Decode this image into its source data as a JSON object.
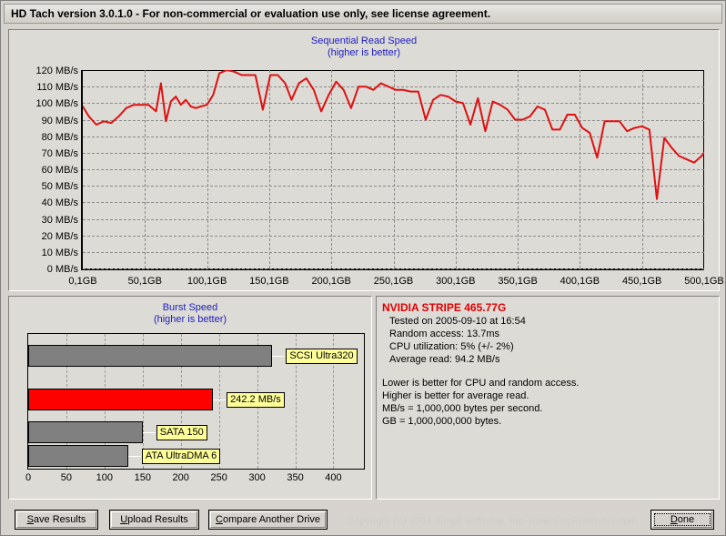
{
  "window": {
    "title": "HD Tach version 3.0.1.0  - For non-commercial or evaluation use only, see license agreement."
  },
  "read_chart": {
    "title": "Sequential Read Speed",
    "subtitle": "(higher is better)"
  },
  "burst_chart": {
    "title": "Burst Speed",
    "subtitle": "(higher is better)"
  },
  "info": {
    "drive_name": "NVIDIA STRIPE 465.77G",
    "tested_on": "Tested on 2005-09-10 at 16:54",
    "random_access": "Random access: 13.7ms",
    "cpu_utilization": "CPU utilization: 5% (+/- 2%)",
    "average_read": "Average read: 94.2 MB/s",
    "note1": "Lower is better for CPU and random access.",
    "note2": "Higher is better for average read.",
    "note3": "MB/s = 1,000,000 bytes per second.",
    "note4": "GB = 1,000,000,000 bytes."
  },
  "buttons": {
    "save": "Save Results",
    "save_accel": "S",
    "upload": "Upload Results",
    "upload_accel": "U",
    "compare": "Compare Another Drive",
    "compare_accel": "C",
    "done": "Done",
    "done_accel": "D"
  },
  "copyright": "Copyright (C) 2004 Simpli Software, Inc. www.simplisoftware.com",
  "colors": {
    "trace": "#e01010",
    "highlight_bar": "#ff0000",
    "reference_bar": "#808080",
    "callout_bg": "#ffff99",
    "title_text": "#2020c0",
    "drive_name": "#e00000"
  },
  "chart_data": [
    {
      "type": "line",
      "title": "Sequential Read Speed",
      "subtitle": "(higher is better)",
      "xlabel": "",
      "ylabel": "MB/s",
      "xlim": [
        0.1,
        500.1
      ],
      "ylim": [
        0,
        120
      ],
      "grid": true,
      "legend": false,
      "yticks": [
        0,
        10,
        20,
        30,
        40,
        50,
        60,
        70,
        80,
        90,
        100,
        110,
        120
      ],
      "ytick_labels": [
        "0 MB/s",
        "10 MB/s",
        "20 MB/s",
        "30 MB/s",
        "40 MB/s",
        "50 MB/s",
        "60 MB/s",
        "70 MB/s",
        "80 MB/s",
        "90 MB/s",
        "100 MB/s",
        "110 MB/s",
        "120 MB/s"
      ],
      "xticks": [
        0.1,
        50.1,
        100.1,
        150.1,
        200.1,
        250.1,
        300.1,
        350.1,
        400.1,
        450.1,
        500.1
      ],
      "xtick_labels": [
        "0,1GB",
        "50,1GB",
        "100,1GB",
        "150,1GB",
        "200,1GB",
        "250,1GB",
        "300,1GB",
        "350,1GB",
        "400,1GB",
        "450,1GB",
        "500,1GB"
      ],
      "series": [
        {
          "name": "Sequential read",
          "color": "#e01010",
          "x": [
            0.1,
            5,
            11,
            17,
            23,
            29,
            35,
            41,
            47,
            53,
            59,
            63,
            67,
            71,
            75,
            79,
            83,
            87,
            91,
            95,
            100,
            105,
            110,
            116,
            122,
            128,
            133,
            139,
            145,
            151,
            157,
            163,
            168,
            174,
            180,
            186,
            192,
            198,
            204,
            210,
            216,
            222,
            228,
            234,
            240,
            246,
            252,
            258,
            264,
            270,
            276,
            282,
            288,
            294,
            300,
            306,
            312,
            318,
            324,
            330,
            336,
            342,
            348,
            354,
            360,
            366,
            372,
            378,
            384,
            390,
            396,
            402,
            408,
            414,
            420,
            426,
            432,
            438,
            444,
            450,
            456,
            462,
            468,
            474,
            480,
            486,
            492,
            498,
            500.1
          ],
          "y": [
            98,
            92,
            87,
            89,
            88,
            92,
            97,
            99,
            99,
            99,
            95,
            112,
            89,
            101,
            104,
            99,
            102,
            98,
            97,
            98,
            99,
            105,
            118,
            120,
            119,
            117,
            117,
            117,
            96,
            117,
            117,
            112,
            102,
            112,
            115,
            108,
            95,
            105,
            113,
            108,
            97,
            110,
            110,
            108,
            112,
            110,
            108,
            108,
            107,
            107,
            90,
            102,
            105,
            104,
            101,
            100,
            87,
            103,
            83,
            101,
            99,
            96,
            90,
            90,
            92,
            98,
            96,
            84,
            84,
            93,
            93,
            85,
            82,
            67,
            89,
            89,
            89,
            83,
            85,
            86,
            84,
            42,
            79,
            73,
            68,
            66,
            64,
            68,
            70
          ]
        }
      ]
    },
    {
      "type": "bar",
      "orientation": "horizontal",
      "title": "Burst Speed",
      "subtitle": "(higher is better)",
      "xlabel": "",
      "ylabel": "",
      "xlim": [
        0,
        440
      ],
      "grid": true,
      "xticks": [
        0,
        50,
        100,
        150,
        200,
        250,
        300,
        350,
        400
      ],
      "xtick_labels": [
        "0",
        "50",
        "100",
        "150",
        "200",
        "250",
        "300",
        "350",
        "400"
      ],
      "categories": [
        "SCSI Ultra320",
        "242.2 MB/s",
        "SATA 150",
        "ATA UltraDMA 6"
      ],
      "values": [
        320,
        242.2,
        150,
        131
      ],
      "labels": [
        "SCSI Ultra320",
        "242.2 MB/s",
        "SATA 150",
        "ATA UltraDMA 6"
      ],
      "colors": [
        "#808080",
        "#ff0000",
        "#808080",
        "#808080"
      ]
    }
  ]
}
